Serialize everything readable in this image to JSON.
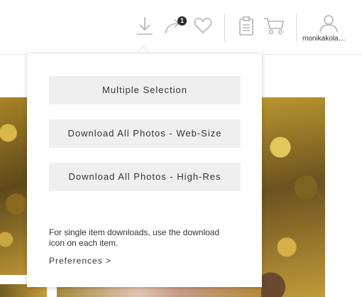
{
  "toolbar": {
    "icons": [
      "download-icon",
      "share-icon",
      "heart-icon",
      "clipboard-icon",
      "cart-icon",
      "user-icon"
    ],
    "share_badge_count": "1",
    "username": "monikakola…"
  },
  "download_menu": {
    "buttons": [
      {
        "label": "Multiple Selection"
      },
      {
        "label": "Download All Photos - Web-Size"
      },
      {
        "label": "Download All Photos - High-Res"
      }
    ],
    "note": "For single item downloads, use the download icon on each item.",
    "preferences_link": "Preferences >"
  },
  "colors": {
    "icon_gray": "#b3b3b3",
    "button_bg": "#efefef",
    "text": "#333333"
  }
}
